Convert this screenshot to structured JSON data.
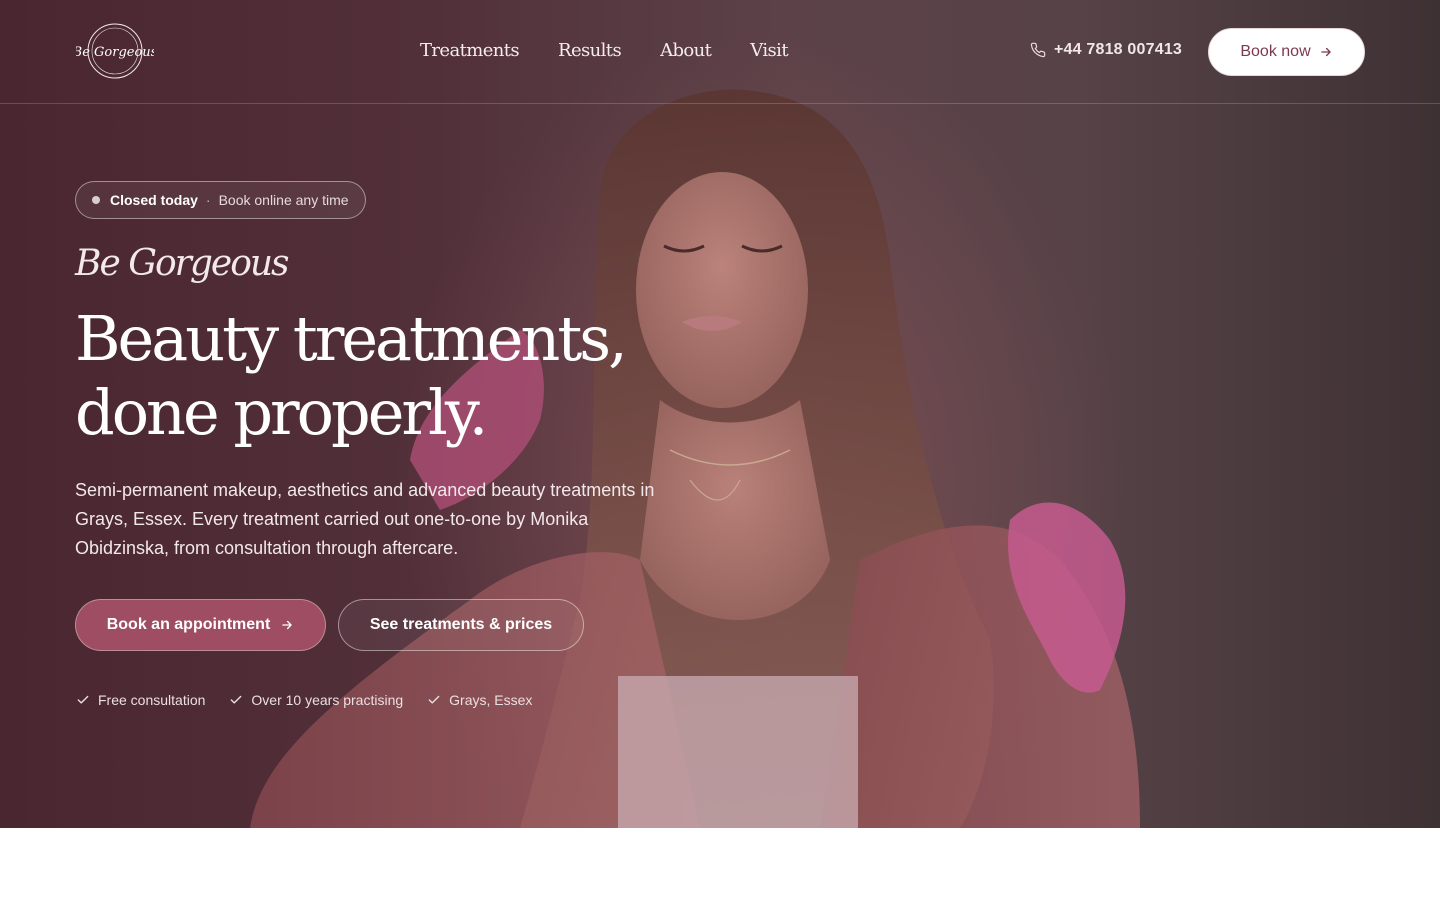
{
  "brand": {
    "logo_text": "Be Gorgeous",
    "logo_ring_top": "BEAUTY CLINIC",
    "logo_ring_bottom": "MONIKA OBIDZINSKA"
  },
  "nav": {
    "items": [
      {
        "label": "Treatments"
      },
      {
        "label": "Results"
      },
      {
        "label": "About"
      },
      {
        "label": "Visit"
      }
    ]
  },
  "header": {
    "phone": "+44 7818 007413",
    "phone_icon": "phone-icon",
    "book_now": "Book now"
  },
  "hero": {
    "status_strong": "Closed today",
    "status_sep": "·",
    "status_soft": "Book online any time",
    "script_title": "Be Gorgeous",
    "headline_line1": "Beauty treatments,",
    "headline_line2": "done properly.",
    "lede": "Semi-permanent makeup, aesthetics and advanced beauty treatments in Grays, Essex. Every treatment carried out one-to-one by Monika Obidzinska, from consultation through aftercare.",
    "cta_primary": "Book an appointment",
    "cta_secondary": "See treatments & prices",
    "perks": [
      {
        "label": "Free consultation"
      },
      {
        "label": "Over 10 years practising"
      },
      {
        "label": "Grays, Essex"
      }
    ]
  },
  "colors": {
    "accent": "#9e4d62",
    "accent_text": "#7b3a4d",
    "hero_dark": "#4a2630"
  }
}
